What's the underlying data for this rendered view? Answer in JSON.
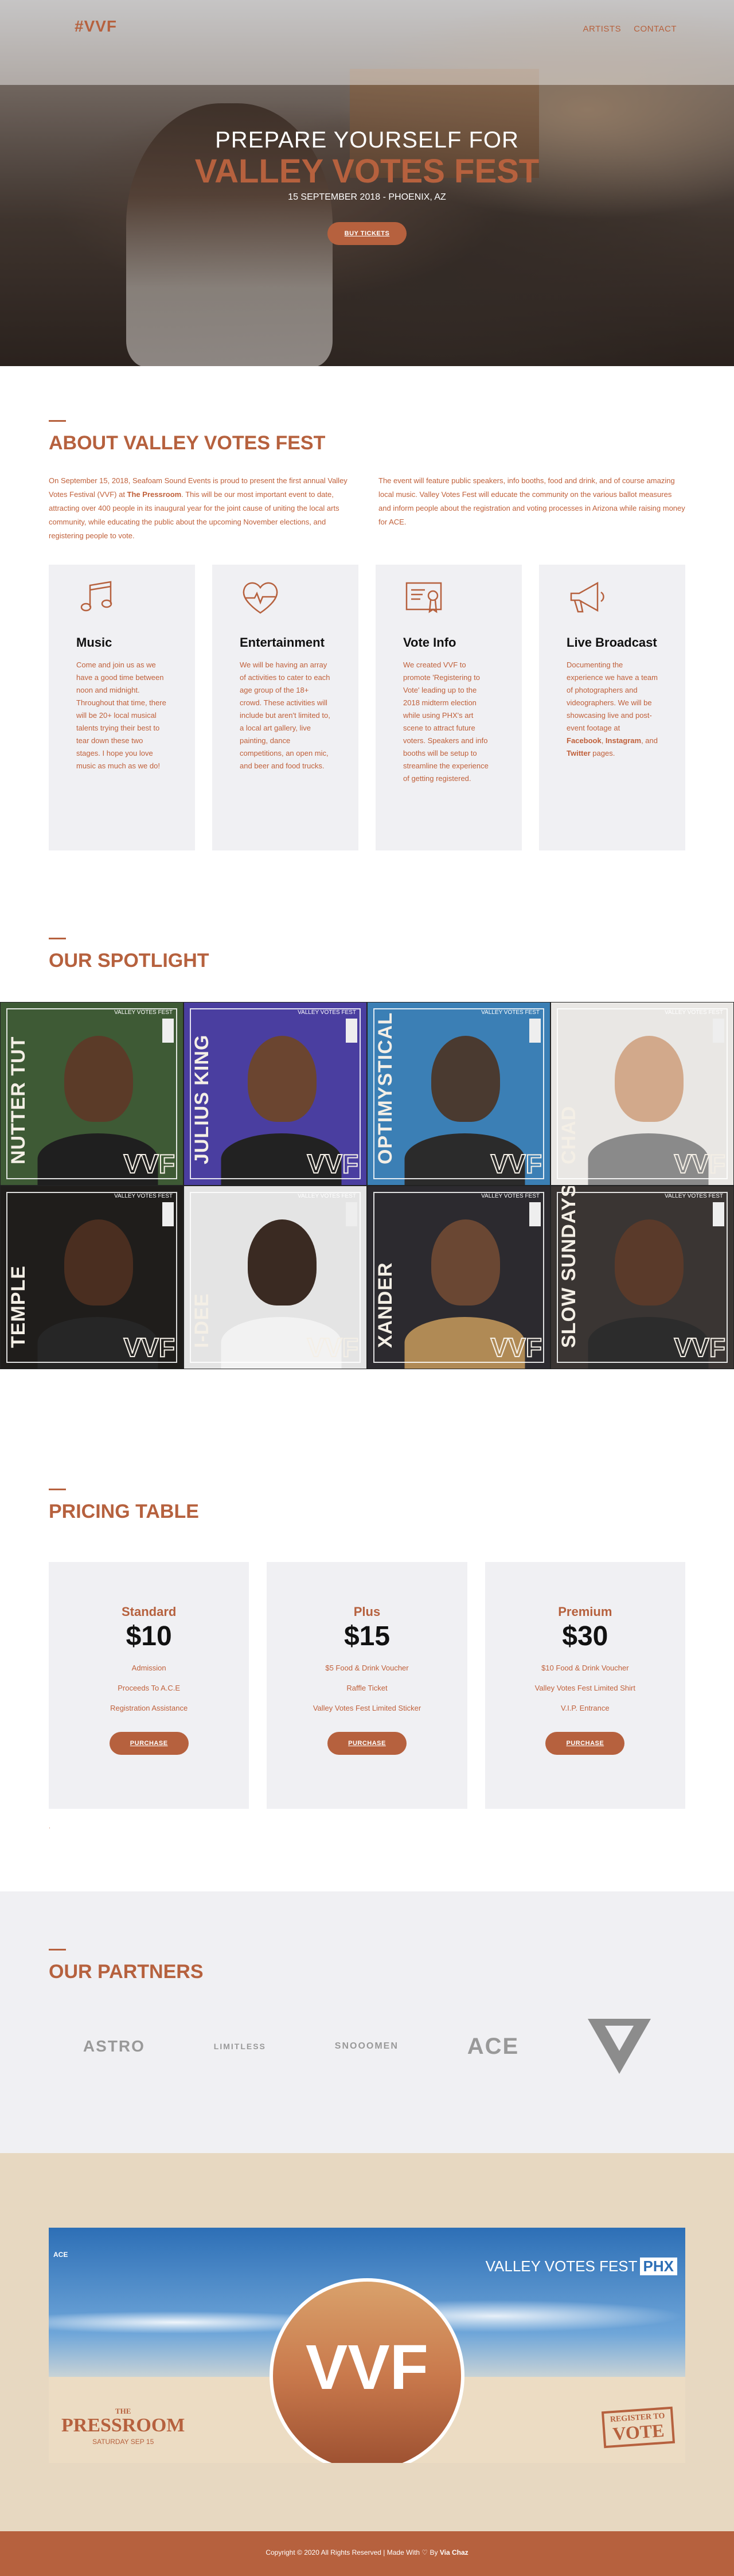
{
  "nav": {
    "logo": "#VVF",
    "links": [
      "ARTISTS",
      "CONTACT"
    ]
  },
  "hero": {
    "pre_title": "PREPARE YOURSELF FOR",
    "title": "VALLEY VOTES FEST",
    "date": "15 SEPTEMBER 2018 - PHOENIX, AZ",
    "cta": "BUY TICKETS"
  },
  "about": {
    "title": "ABOUT VALLEY VOTES FEST",
    "col1_a": "On September 15, 2018, Seafoam Sound Events is proud to present the first annual Valley Votes Festival (VVF) at ",
    "col1_b": "The Pressroom",
    "col1_c": ". This will be our most important event to date, attracting over 400 people in its inaugural year for the joint cause of uniting the local arts community, while educating the public about the upcoming November elections, and registering people to vote.",
    "col2": "The event will feature public speakers, info booths, food and drink, and of course amazing local music. Valley Votes Fest will educate the community on the various ballot measures and inform people about the registration and voting processes in Arizona while raising money for ACE.",
    "features": [
      {
        "icon": "music-note-icon",
        "title": "Music",
        "text": "Come and join us as we have a good time between noon and midnight. Throughout that time, there will be 20+ local musical talents trying their best to tear down these two stages. I hope you love music as much as we do!"
      },
      {
        "icon": "heart-pulse-icon",
        "title": "Entertainment",
        "text": "We will be having an array of activities to cater to each age group of the 18+ crowd. These activities will include but aren't limited to, a local art gallery, live painting, dance competitions, an open mic, and beer and food trucks."
      },
      {
        "icon": "certificate-icon",
        "title": "Vote Info",
        "text": "We created VVF to promote 'Registering to Vote' leading up to the 2018 midterm election while using PHX's art scene to attract future voters. Speakers and info booths will be setup to streamline the experience of getting registered."
      },
      {
        "icon": "megaphone-icon",
        "title": "Live Broadcast",
        "text_a": "Documenting the experience we have a team of photographers and videographers. We will be showcasing live and post-event footage at ",
        "facebook": "Facebook",
        "sep1": ", ",
        "instagram": "Instagram",
        "sep2": ", and ",
        "twitter": "Twitter",
        "text_b": " pages."
      }
    ]
  },
  "spotlight": {
    "title": "OUR SPOTLIGHT",
    "brand": "VALLEY VOTES FEST",
    "badge": "VVF",
    "artists": [
      {
        "name": "NUTTER TUT",
        "bg": "#3e5a35",
        "face": "#5b3b28",
        "shirt": "#1f1f1f"
      },
      {
        "name": "JULIUS KING",
        "bg": "#4a3ea0",
        "face": "#6b4530",
        "shirt": "#222"
      },
      {
        "name": "OPTIMYSTICAL",
        "bg": "#3b7fb5",
        "face": "#4a3a30",
        "shirt": "#2b2b2b"
      },
      {
        "name": "CHAD",
        "bg": "#e9e7e4",
        "face": "#d2a98b",
        "shirt": "#8a8a8a"
      },
      {
        "name": "TEMPLE",
        "bg": "#1f1d1b",
        "face": "#4a2e20",
        "shirt": "#262626"
      },
      {
        "name": "I-DEE",
        "bg": "#e4e4e4",
        "face": "#3a2a22",
        "shirt": "#f2f2f2"
      },
      {
        "name": "XANDER",
        "bg": "#2c2a2f",
        "face": "#6a4733",
        "shirt": "#b08a55"
      },
      {
        "name": "SLOW SUNDAYS",
        "bg": "#3a3533",
        "face": "#5a3a2a",
        "shirt": "#2c2c2c"
      }
    ]
  },
  "pricing": {
    "title": "PRICING TABLE",
    "plans": [
      {
        "name": "Standard",
        "price": "$10",
        "features": [
          "Admission",
          "Proceeds To A.C.E",
          "Registration Assistance"
        ],
        "cta": "PURCHASE"
      },
      {
        "name": "Plus",
        "price": "$15",
        "features": [
          "$5 Food & Drink Voucher",
          "Raffle Ticket",
          "Valley Votes Fest Limited Sticker"
        ],
        "cta": "PURCHASE"
      },
      {
        "name": "Premium",
        "price": "$30",
        "features": [
          "$10 Food & Drink Voucher",
          "Valley Votes Fest Limited Shirt",
          "V.I.P. Entrance"
        ],
        "cta": "PURCHASE"
      }
    ],
    "note": "."
  },
  "partners": {
    "title": "OUR PARTNERS",
    "logos": [
      "ASTRO",
      "LIMITLESS",
      "SNOOOMEN",
      "ACE",
      "V"
    ]
  },
  "promo": {
    "vvf": "VVF",
    "valley": "VALLEY VOTES FEST",
    "phx": "PHX",
    "ace": "ACE",
    "press_the": "THE",
    "press_name": "PRESSROOM",
    "press_date": "SATURDAY SEP 15",
    "register_to": "REGISTER TO",
    "vote": "VOTE"
  },
  "footer": {
    "text": "Copyright © 2020 All Rights Reserved | Made With ♡ By ",
    "author": "Via Chaz"
  }
}
